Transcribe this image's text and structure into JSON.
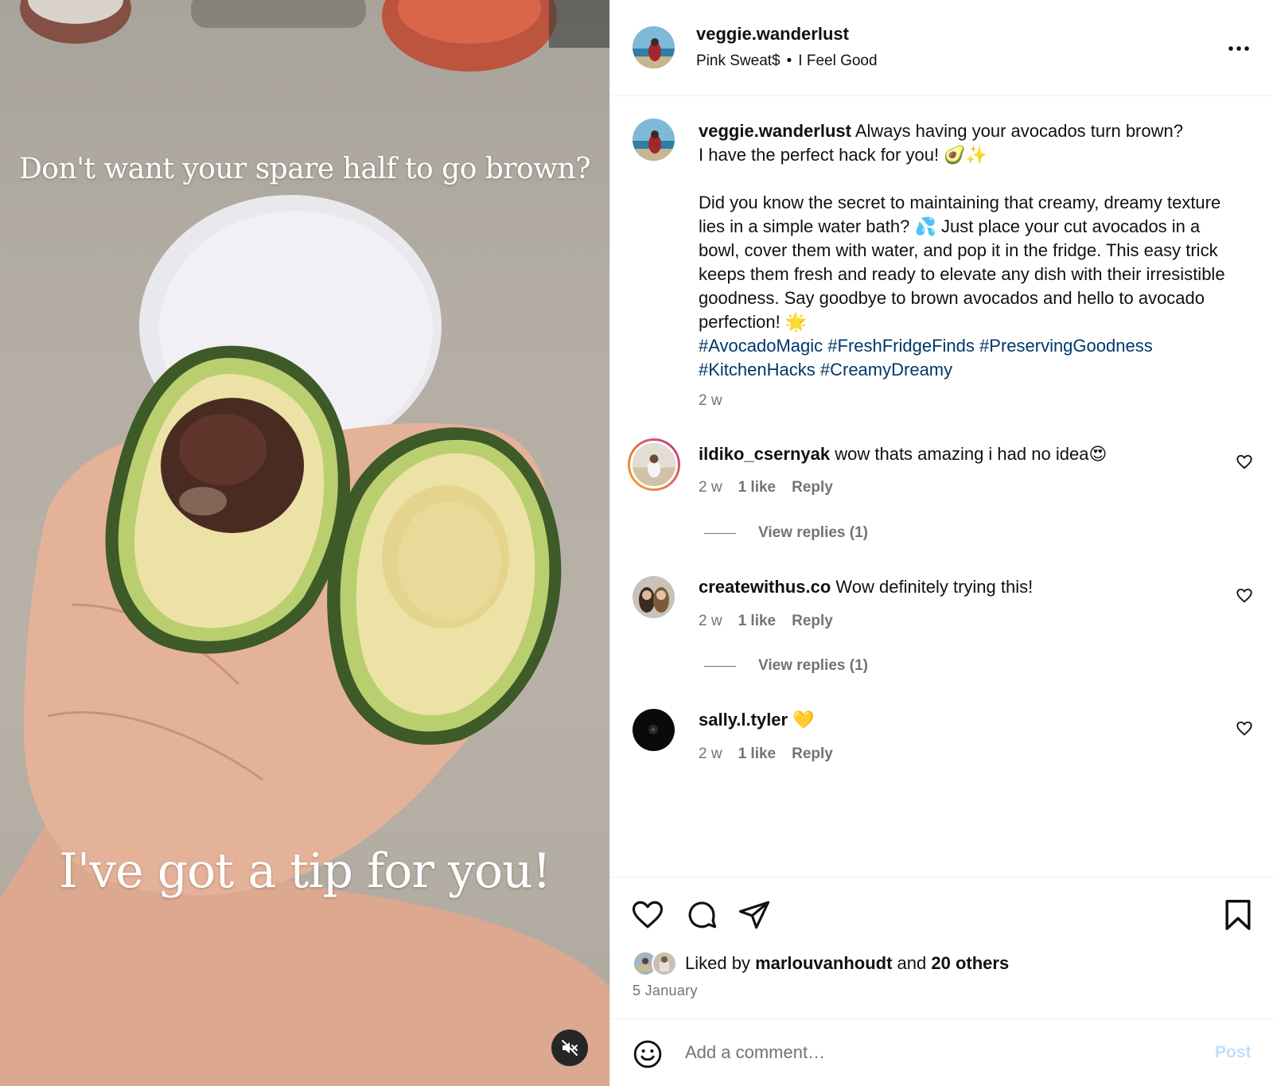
{
  "video": {
    "caption_top": "Don't want your spare half to go brown?",
    "caption_bottom": "I've got a tip for you!"
  },
  "header": {
    "username": "veggie.wanderlust",
    "audio_artist": "Pink Sweat$",
    "audio_separator": "•",
    "audio_track": "I Feel Good"
  },
  "caption": {
    "username": "veggie.wanderlust",
    "line1": "Always having your avocados turn brown?",
    "line2": "I have the perfect hack for you! 🥑✨",
    "body": "Did you know the secret to maintaining that creamy, dreamy texture lies in a simple water bath? 💦 Just place your cut avocados in a bowl, cover them with water, and pop it in the fridge. This easy trick keeps them fresh and ready to elevate any dish with their irresistible goodness. Say goodbye to brown avocados and hello to avocado perfection! 🌟",
    "hashtags": [
      "#AvocadoMagic",
      "#FreshFridgeFinds",
      "#PreservingGoodness",
      "#KitchenHacks",
      "#CreamyDreamy"
    ],
    "time": "2 w"
  },
  "comments": [
    {
      "username": "ildiko_csernyak",
      "text": "wow thats amazing i had no idea😍",
      "time": "2 w",
      "likes": "1 like",
      "reply_label": "Reply",
      "view_replies": "View replies (1)"
    },
    {
      "username": "createwithus.co",
      "text": "Wow definitely trying this!",
      "time": "2 w",
      "likes": "1 like",
      "reply_label": "Reply",
      "view_replies": "View replies (1)"
    },
    {
      "username": "sally.l.tyler",
      "text": "💛",
      "time": "2 w",
      "likes": "1 like",
      "reply_label": "Reply"
    }
  ],
  "likes": {
    "prefix": "Liked by",
    "user": "marlouvanhoudt",
    "conjunction": "and",
    "others": "20 others"
  },
  "post_date": "5 January",
  "comment_bar": {
    "placeholder": "Add a comment…",
    "post_label": "Post"
  },
  "icons": {
    "like": "heart-icon",
    "comment": "comment-icon",
    "share": "send-icon",
    "save": "bookmark-icon",
    "more": "more-icon",
    "mute": "speaker-muted-icon",
    "emoji": "emoji-icon"
  },
  "colors": {
    "hashtag": "#00376b",
    "muted_text": "#737373",
    "post_button_disabled": "#c0dffd",
    "story_ring_start": "#f9a825",
    "story_ring_end": "#c13584"
  }
}
